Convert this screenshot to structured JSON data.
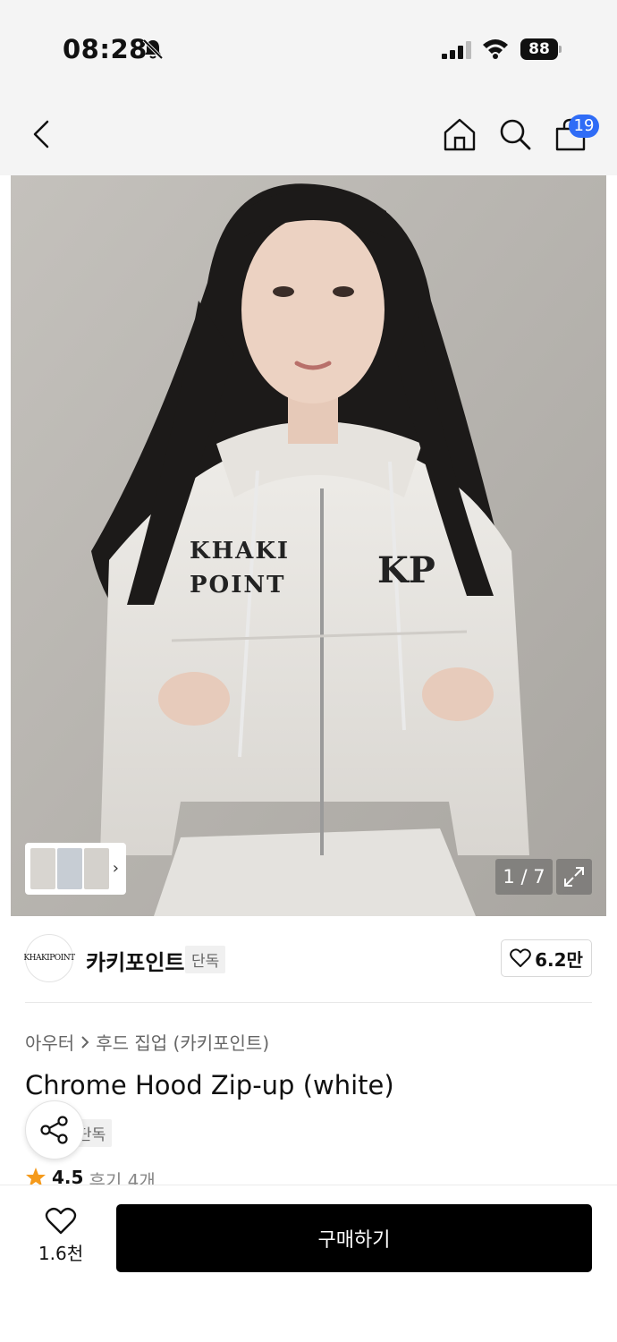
{
  "status_bar": {
    "time": "08:28",
    "battery": "88",
    "icons": [
      "bell-off-icon",
      "signal-icon",
      "wifi-icon",
      "battery-icon"
    ]
  },
  "nav": {
    "icons": [
      "back-icon",
      "home-icon",
      "search-icon",
      "cart-icon"
    ],
    "cart_badge": "19"
  },
  "gallery": {
    "counter": "1 / 7",
    "icons": [
      "chevron-right-icon",
      "expand-icon"
    ]
  },
  "brand": {
    "logo_text": "KHAKIPOINT",
    "name": "카키포인트",
    "tag": "단독",
    "likes": "6.2만"
  },
  "product": {
    "breadcrumb_category": "아우터",
    "breadcrumb_sub": "후드 집업 (카키포인트)",
    "title": "Chrome Hood Zip-up (white)",
    "exclusive_tag": "단독",
    "rating": "4.5",
    "reviews": "후기 4개"
  },
  "bottom_bar": {
    "wish_count": "1.6천",
    "buy_label": "구매하기"
  },
  "colors": {
    "accent": "#2f6cf6",
    "star": "#f59a1b",
    "buy_button": "#000000"
  }
}
